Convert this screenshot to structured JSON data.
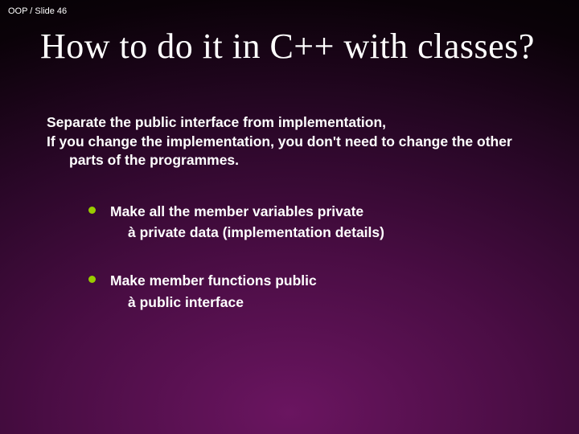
{
  "header": "OOP / Slide 46",
  "title": "How to do it in C++ with classes?",
  "intro": {
    "line1": "Separate the public interface from implementation,",
    "line2": "If you change the implementation, you don't need to change the other parts of the programmes."
  },
  "bullets": [
    {
      "main": "Make all the member variables private",
      "sub": "à private data (implementation details)"
    },
    {
      "main": "Make member functions public",
      "sub": "à public interface"
    }
  ]
}
